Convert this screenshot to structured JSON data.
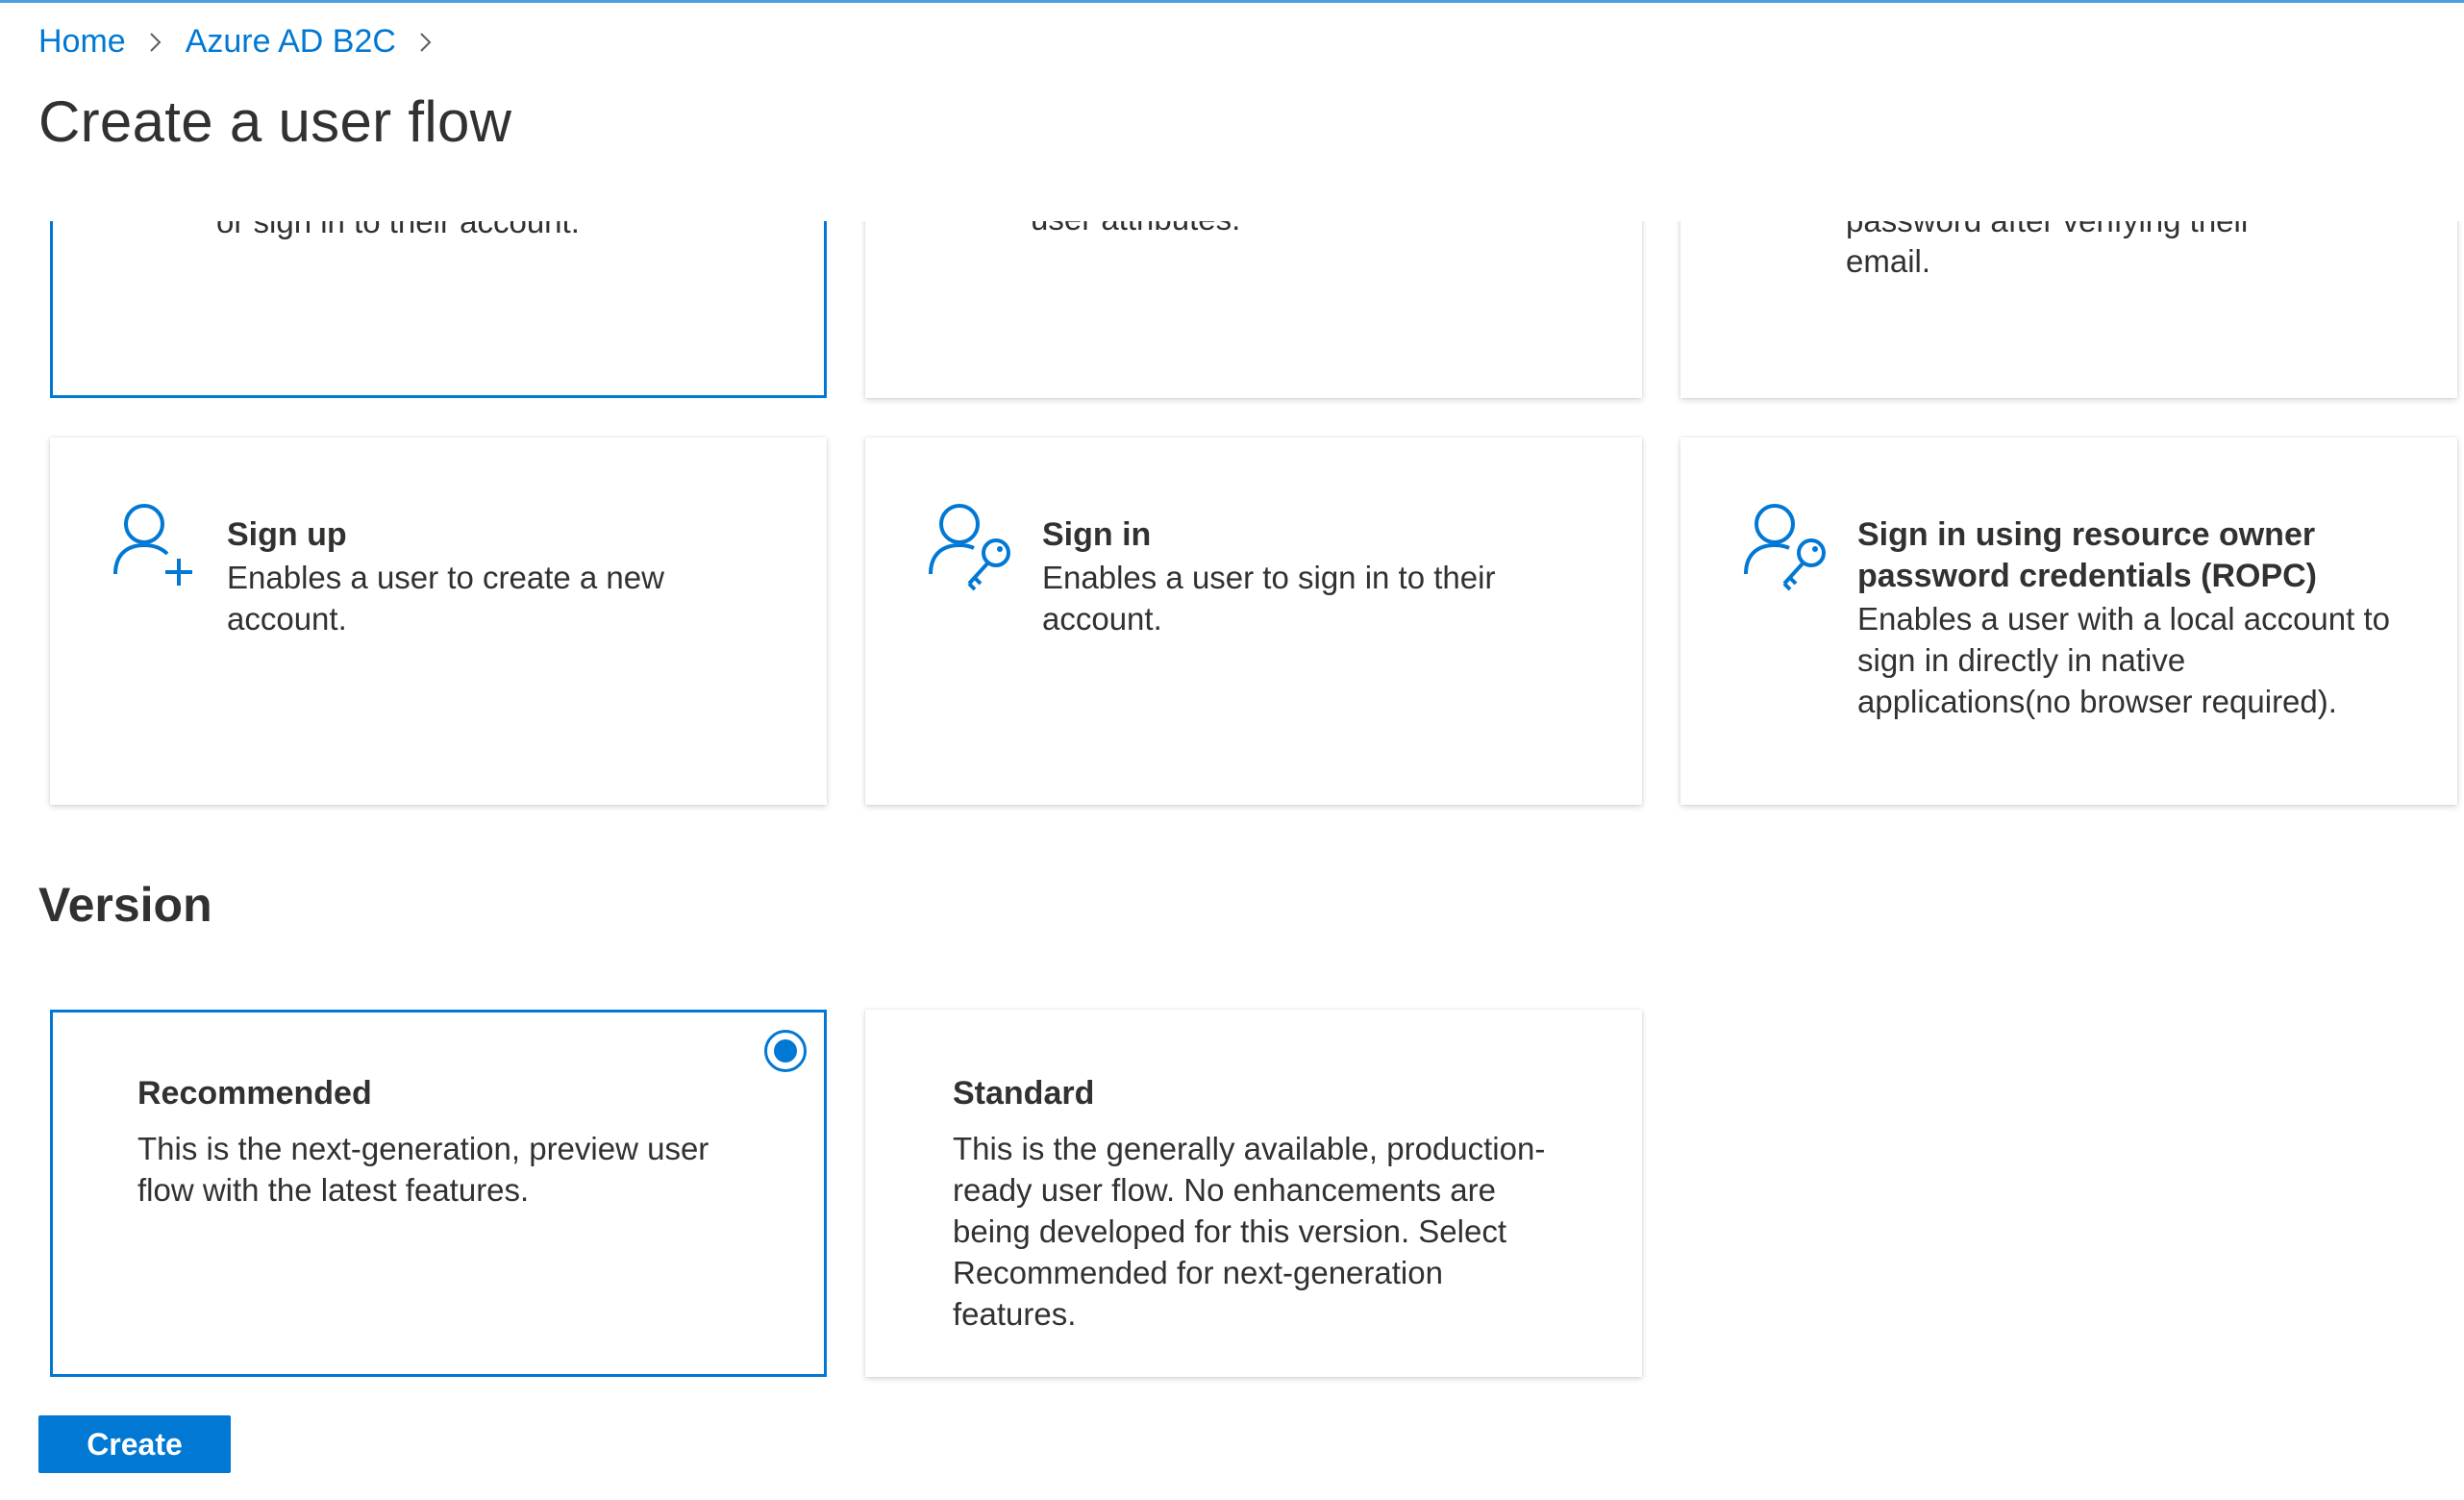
{
  "breadcrumb": {
    "home": "Home",
    "tenant": "Azure AD B2C"
  },
  "page": {
    "title": "Create a user flow"
  },
  "partial_cards": [
    {
      "fragment": "or sign in to their account."
    },
    {
      "fragment": "user attributes."
    },
    {
      "fragment_top": "password after verifying their",
      "fragment_bottom": "email."
    }
  ],
  "flow_types": [
    {
      "title": "Sign up",
      "description": "Enables a user to create a new account.",
      "icon": "user-add-icon"
    },
    {
      "title": "Sign in",
      "description": "Enables a user to sign in to their account.",
      "icon": "user-key-icon"
    },
    {
      "title": "Sign in using resource owner password credentials (ROPC)",
      "description": "Enables a user with a local account to sign in directly in native applications(no browser required).",
      "icon": "user-key-icon"
    }
  ],
  "version": {
    "section_title": "Version",
    "options": [
      {
        "title": "Recommended",
        "description": "This is the next-generation, preview user flow with the latest features.",
        "selected": true
      },
      {
        "title": "Standard",
        "description": "This is the generally available, production-ready user flow. No enhancements are being developed for this version. Select Recommended for next-generation features.",
        "selected": false
      }
    ]
  },
  "actions": {
    "create_label": "Create"
  },
  "colors": {
    "accent": "#0078d4",
    "text": "#323130"
  }
}
